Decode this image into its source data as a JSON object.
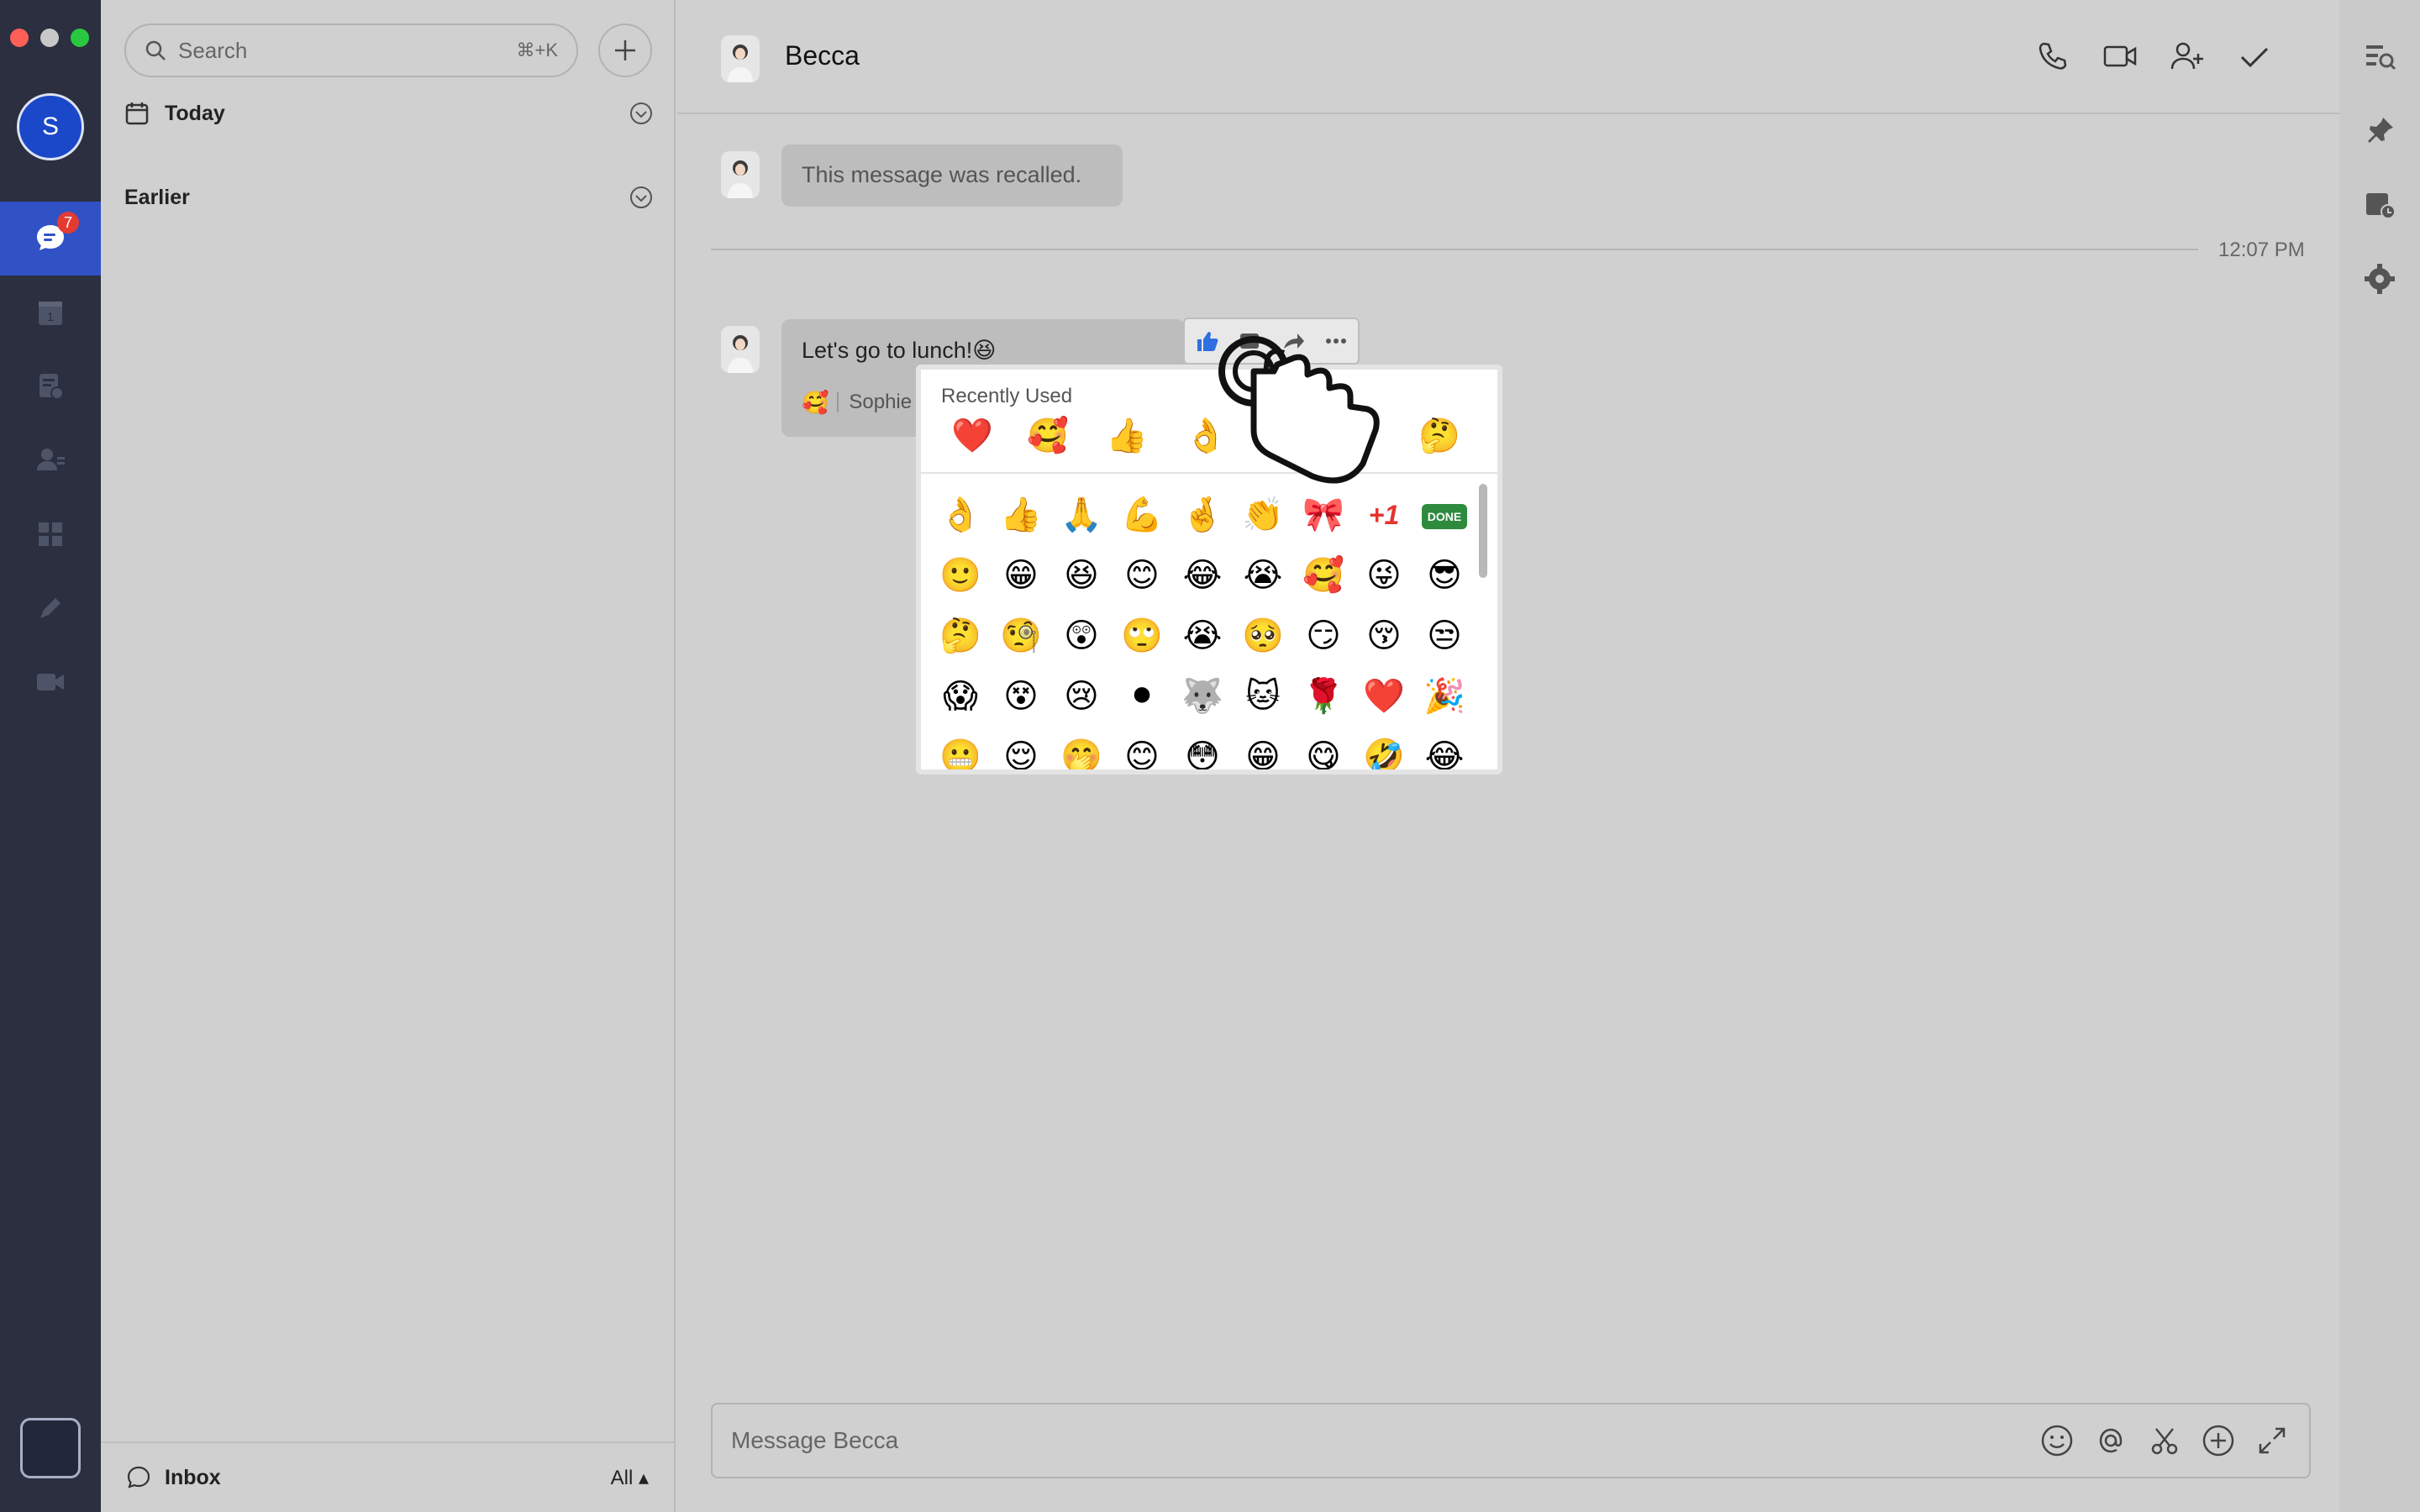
{
  "sidebar": {
    "search": {
      "placeholder": "Search",
      "shortcut": "⌘+K"
    },
    "sections": [
      {
        "title": "Today"
      },
      {
        "title": "Earlier"
      }
    ],
    "bottom": {
      "label": "Inbox",
      "filter": "All ▴"
    }
  },
  "rail": {
    "avatar_initial": "S",
    "chat_badge": "7"
  },
  "chat": {
    "contact_name": "Becca",
    "messages": [
      {
        "text": "This message was recalled."
      },
      {
        "text": "Let's go to lunch!😆",
        "reaction_name": "Sophie"
      }
    ],
    "timestamp": "12:07 PM",
    "composer_placeholder": "Message Becca"
  },
  "emoji_picker": {
    "recent_title": "Recently Used",
    "recent": [
      "❤️",
      "🥰",
      "👍",
      "👌",
      "🌹",
      "🤔"
    ],
    "grid": [
      [
        "👌",
        "👍",
        "🙏",
        "💪",
        "🤞",
        "👏",
        "🎀",
        "+1",
        "DONE"
      ],
      [
        "🙂",
        "😁",
        "😆",
        "😊",
        "😂",
        "😭",
        "🥰",
        "😜",
        "😎"
      ],
      [
        "🤔",
        "🧐",
        "😲",
        "🙄",
        "😭",
        "🥺",
        "😏",
        "😚",
        "😒"
      ],
      [
        "😱",
        "😵",
        "😢",
        "⚫",
        "🐺",
        "🐱",
        "🌹",
        "❤️",
        "🎉"
      ],
      [
        "😬",
        "😌",
        "🤭",
        "😊",
        "😳",
        "😁",
        "😋",
        "🤣",
        "😂"
      ]
    ]
  },
  "colors": {
    "rail_bg": "#2b2f3f",
    "rail_active": "#3052c5",
    "badge": "#e33b32"
  }
}
